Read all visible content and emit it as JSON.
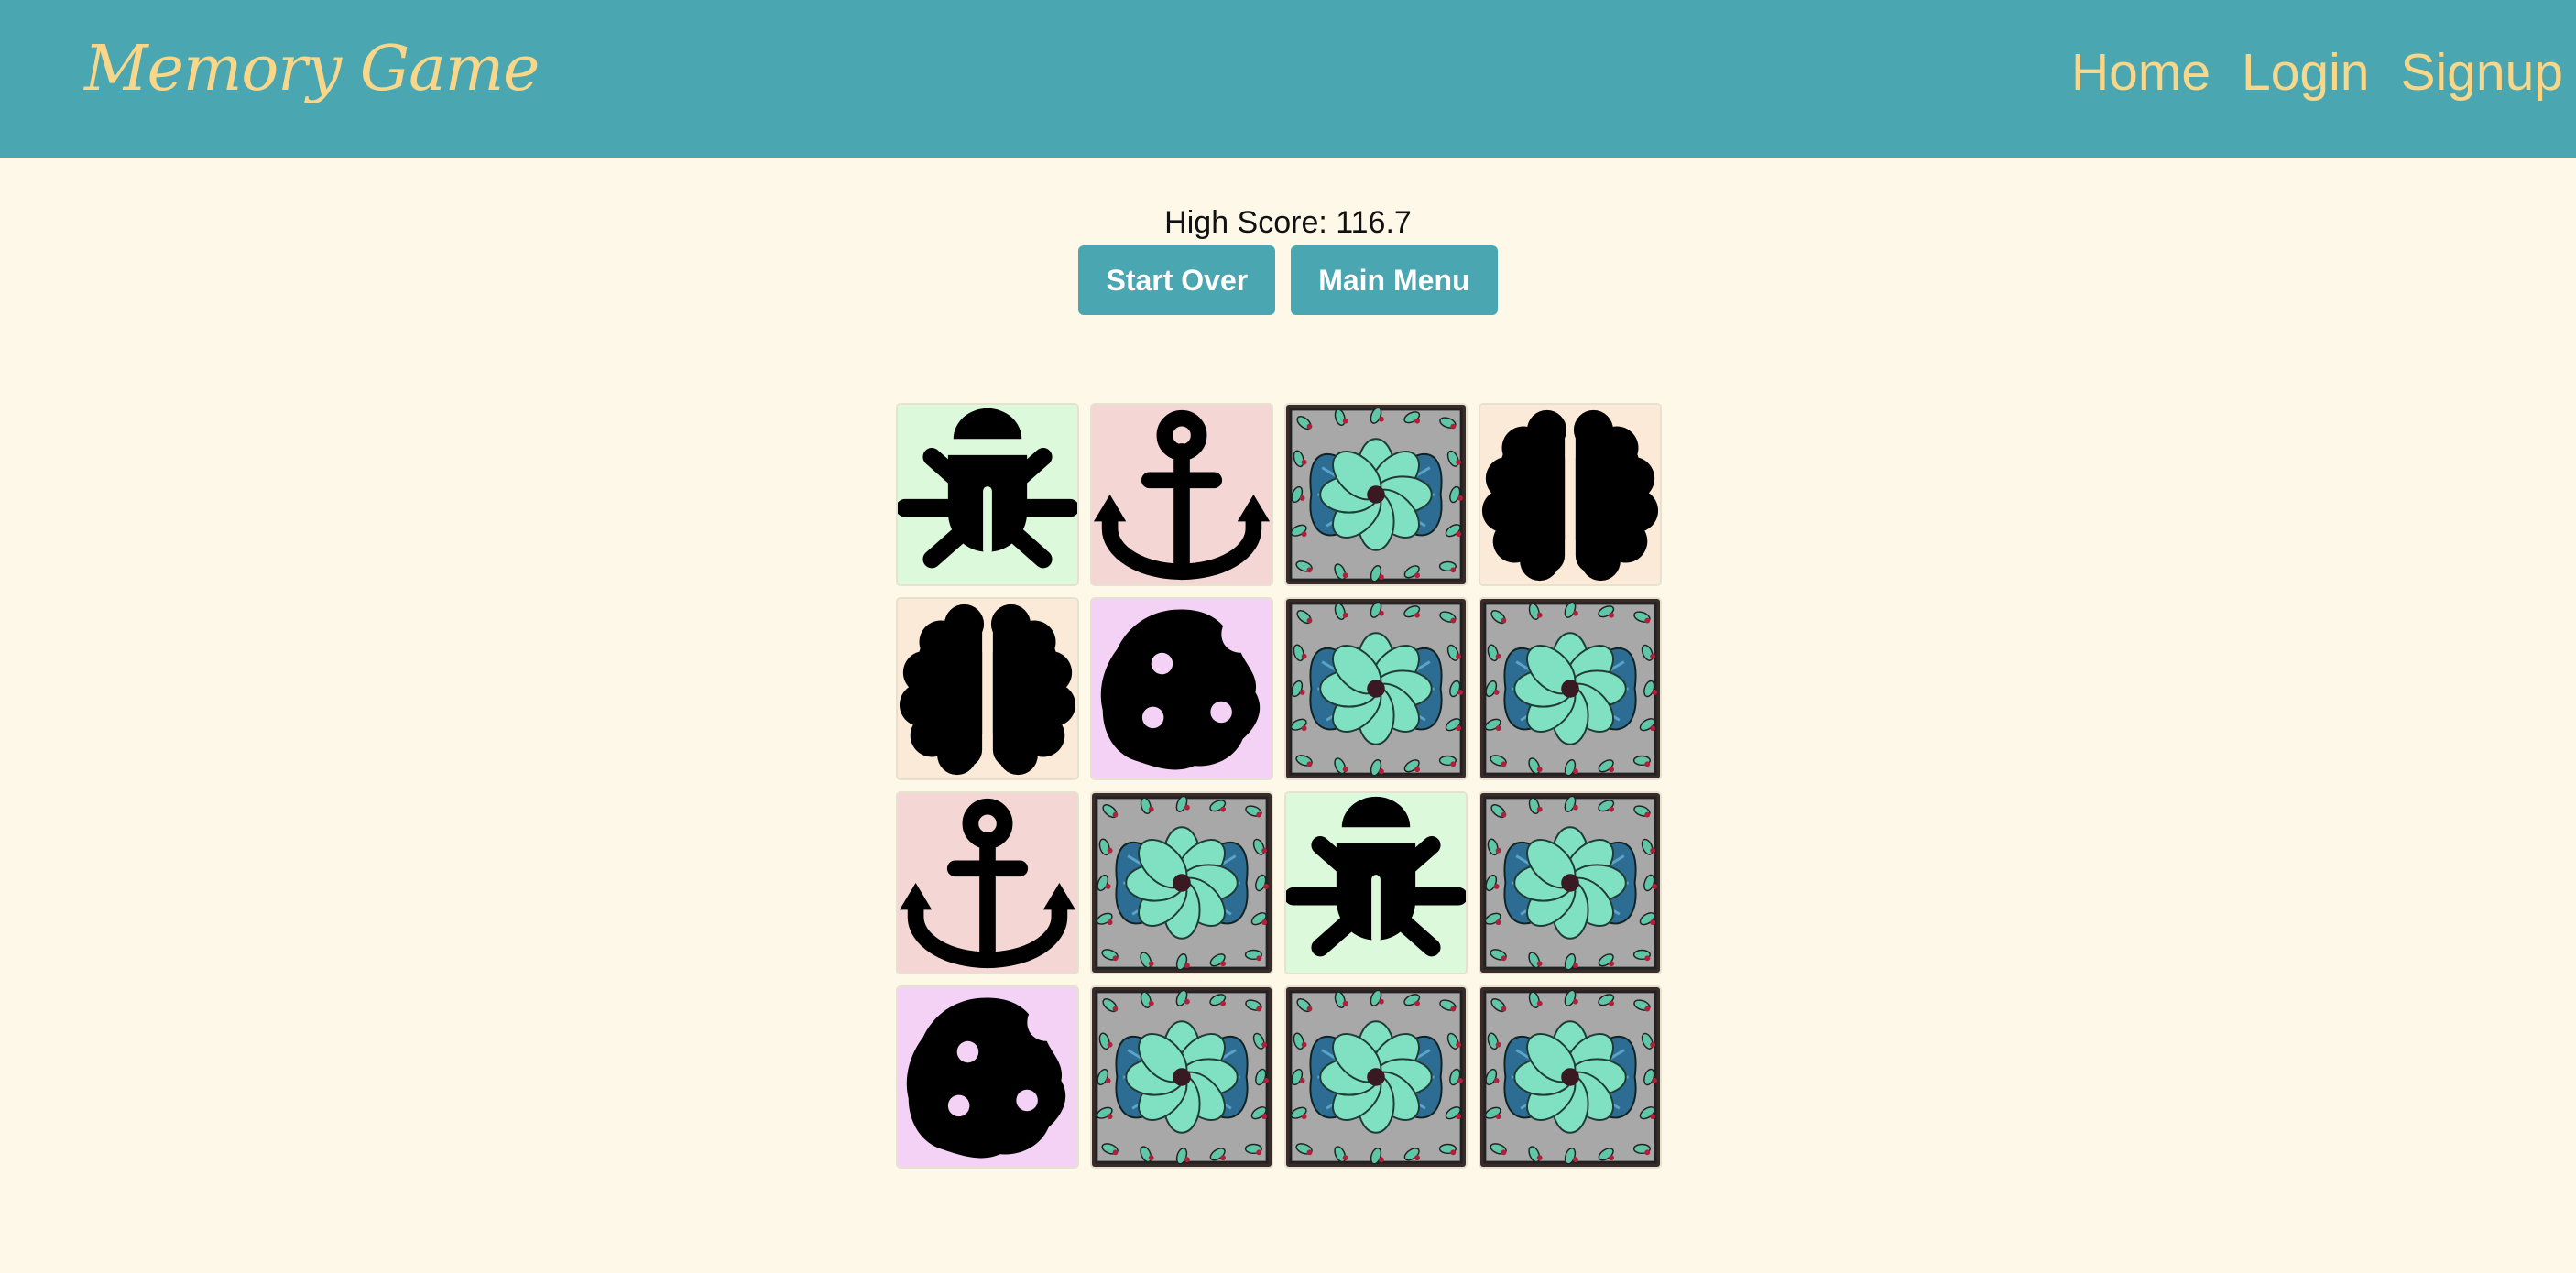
{
  "header": {
    "brand": "Memory Game",
    "nav": [
      "Home",
      "Login",
      "Signup"
    ]
  },
  "score": {
    "text": "High Score: 116.7"
  },
  "buttons": {
    "start_over": "Start Over",
    "main_menu": "Main Menu"
  },
  "colors": {
    "primary": "#4aa7b1",
    "accent_text": "#f8d68a",
    "background": "#fdf8e8",
    "bug_bg": "#dcfadb",
    "anchor_bg": "#f4d6d4",
    "brain_bg": "#fbead8",
    "cookie_bg": "#f3d2f6"
  },
  "board": {
    "columns": 4,
    "cards": [
      {
        "face": "bug",
        "revealed": true
      },
      {
        "face": "anchor",
        "revealed": true
      },
      {
        "face": "card-back",
        "revealed": false
      },
      {
        "face": "brain",
        "revealed": true
      },
      {
        "face": "brain",
        "revealed": true
      },
      {
        "face": "cookie",
        "revealed": true
      },
      {
        "face": "card-back",
        "revealed": false
      },
      {
        "face": "card-back",
        "revealed": false
      },
      {
        "face": "anchor",
        "revealed": true
      },
      {
        "face": "card-back",
        "revealed": false
      },
      {
        "face": "bug",
        "revealed": true
      },
      {
        "face": "card-back",
        "revealed": false
      },
      {
        "face": "cookie",
        "revealed": true
      },
      {
        "face": "card-back",
        "revealed": false
      },
      {
        "face": "card-back",
        "revealed": false
      },
      {
        "face": "card-back",
        "revealed": false
      }
    ]
  }
}
